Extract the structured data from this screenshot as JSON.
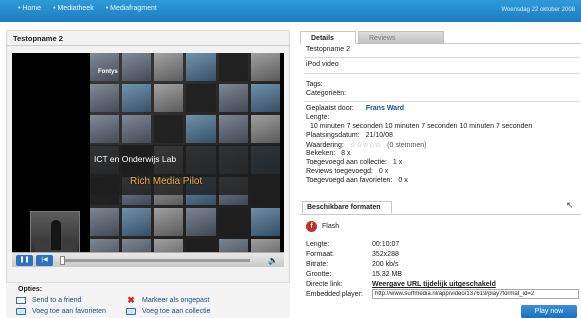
{
  "topbar": {
    "nav": [
      "Home",
      "Mediatheek",
      "Mediafragment"
    ],
    "date": "Woensdag 22 oktober 2008",
    "colors": {
      "bar": "#2385c8"
    }
  },
  "left": {
    "title": "Testopname 2",
    "slide": {
      "logo": "Fontys",
      "title": "ICT en Onderwijs Lab",
      "subtitle": "Rich Media Pilot"
    },
    "player": {
      "progress": 0.0,
      "play_icon": "pause-icon",
      "rew_icon": "rewind-icon",
      "volume_icon": "speaker-icon"
    },
    "options": {
      "label": "Opties:",
      "send": "Send to a friend",
      "favorites": "Voeg toe aan favorieten",
      "flag": "Markeer als ongepast",
      "collection": "Voeg toe aan collectie"
    }
  },
  "tabs": {
    "details": "Details",
    "reviews": "Reviews"
  },
  "details": {
    "name": "Testopname 2",
    "format": "iPod video",
    "tags_label": "Tags:",
    "categories_label": "Categorieën:",
    "posted_label": "Geplaatst door:",
    "posted_value": "Frans Ward",
    "length_label": "Lengte:",
    "length_value": "10 minuten 7 seconden 10 minuten 7 seconden 10 minuten 7 seconden",
    "date_label": "Plaatsingsdatum:",
    "date_value": "21/10/08",
    "rating_label": "Waardering:",
    "rating_stars": "☆☆☆☆☆",
    "rating_votes": "(0 stemmen)",
    "rating_value": 0,
    "views_label": "Bekeken:",
    "views_value": "8  x",
    "collection_label": "Toegevoegd aan collectie:",
    "collection_value": "1  x",
    "reviews_label": "Reviews toegevoegd:",
    "reviews_value": "0  x",
    "favorites_label": "Toegevoegd aan favorieten:",
    "favorites_value": "0  x"
  },
  "formats": {
    "title": "Beschikbare formaten",
    "type": "Flash",
    "length_label": "Lengte:",
    "length_value": "00:10:07",
    "format_label": "Formaat:",
    "format_value": "352x288",
    "bitrate_label": "Bitrate:",
    "bitrate_value": "200 kb/s",
    "size_label": "Grootte:",
    "size_value": "15.32 MB",
    "direct_label": "Directe link:",
    "direct_value": "Weergave URL tijdelijk uitgeschakeld",
    "embed_label": "Embedded player:",
    "embed_value": "http://www.surfmedia.nl/app/video/137619/play?format_id=2",
    "play_button": "Play now"
  }
}
